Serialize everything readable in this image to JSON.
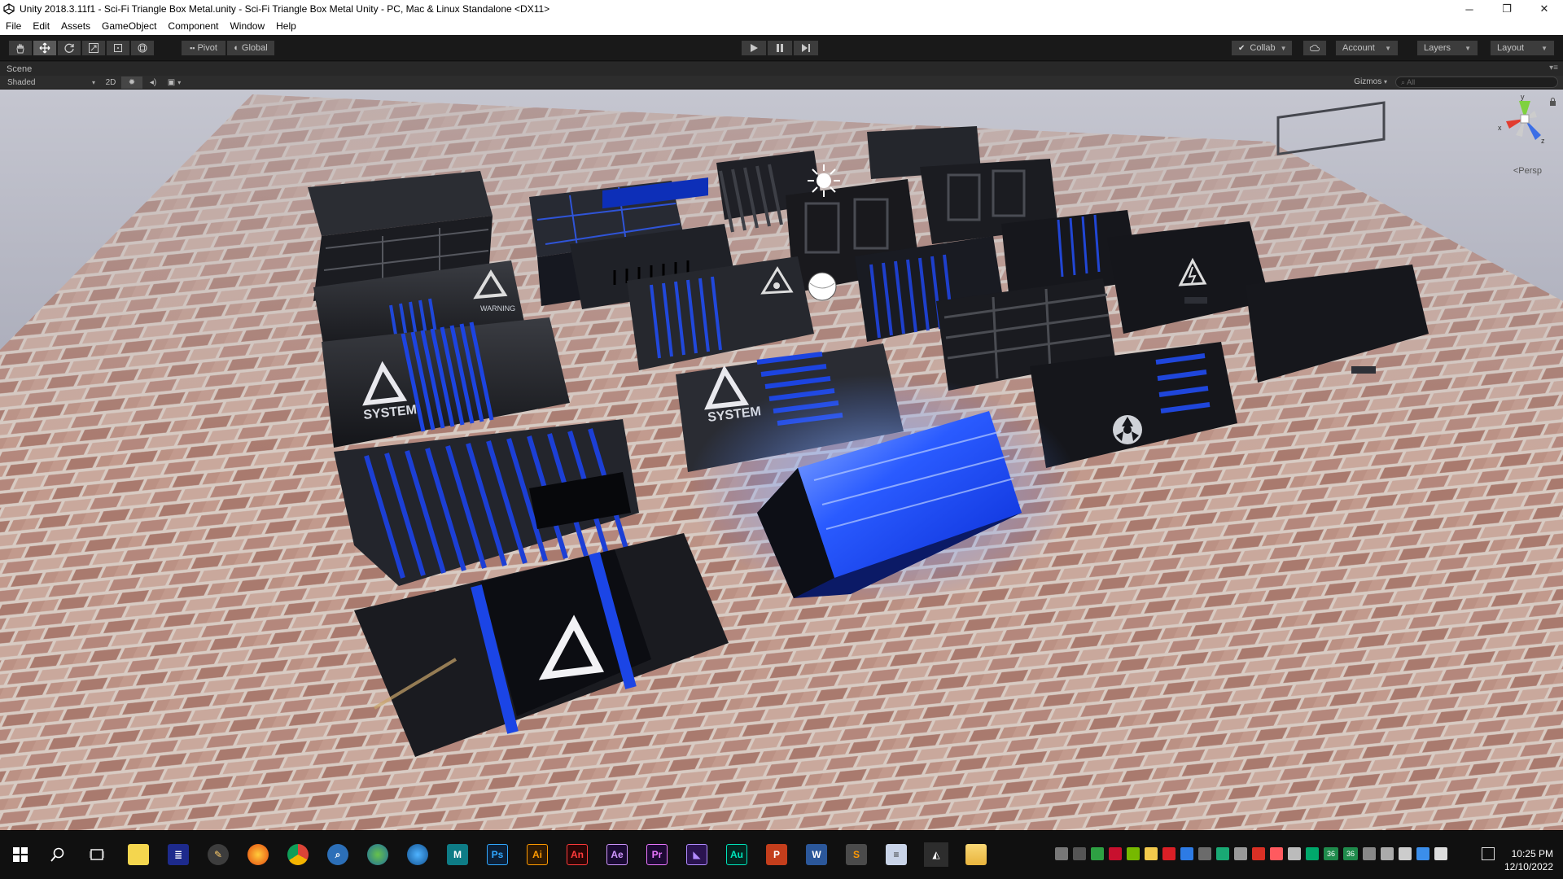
{
  "window": {
    "title": "Unity 2018.3.11f1 - Sci-Fi Triangle Box Metal.unity - Sci-Fi Triangle Box Metal Unity - PC, Mac & Linux Standalone <DX11>",
    "minimize": "─",
    "restore": "❐",
    "close": "✕"
  },
  "menu": [
    "File",
    "Edit",
    "Assets",
    "GameObject",
    "Component",
    "Window",
    "Help"
  ],
  "toolbar": {
    "pivot": "Pivot",
    "global": "Global",
    "collab": "Collab",
    "account": "Account",
    "layers": "Layers",
    "layout": "Layout"
  },
  "scene_tab": {
    "label": "Scene"
  },
  "scene_toolbar": {
    "shading": "Shaded",
    "mode_2d": "2D",
    "gizmos": "Gizmos",
    "search_placeholder": "All"
  },
  "scene_view": {
    "projection": "Persp"
  },
  "crate_labels": [
    "WARNING",
    "SYSTEM",
    "SYSTEM"
  ],
  "taskbar": {
    "pinned": [
      "windows-start",
      "search",
      "task-view",
      "file-explorer",
      "editor",
      "paint-3d",
      "firefox",
      "chrome",
      "magnifier",
      "globe",
      "earth",
      "maya",
      "photoshop",
      "illustrator",
      "animate",
      "after-effects",
      "premiere",
      "vs",
      "audition",
      "powerpoint",
      "word",
      "sublime",
      "notepad",
      "unity",
      "folder"
    ],
    "app_letters": {
      "photoshop": "Ps",
      "illustrator": "Ai",
      "animate": "An",
      "after_effects": "Ae",
      "premiere": "Pr",
      "audition": "Au",
      "word": "W",
      "powerpoint": "P"
    },
    "tray_badge_1": "36",
    "tray_badge_2": "36",
    "time": "10:25 PM",
    "date": "12/10/2022"
  },
  "colors": {
    "accent_blue": "#1a4dff",
    "toolbar_bg": "#191919",
    "scene_sky": "#a7a9b7",
    "brick": "#b08478"
  }
}
